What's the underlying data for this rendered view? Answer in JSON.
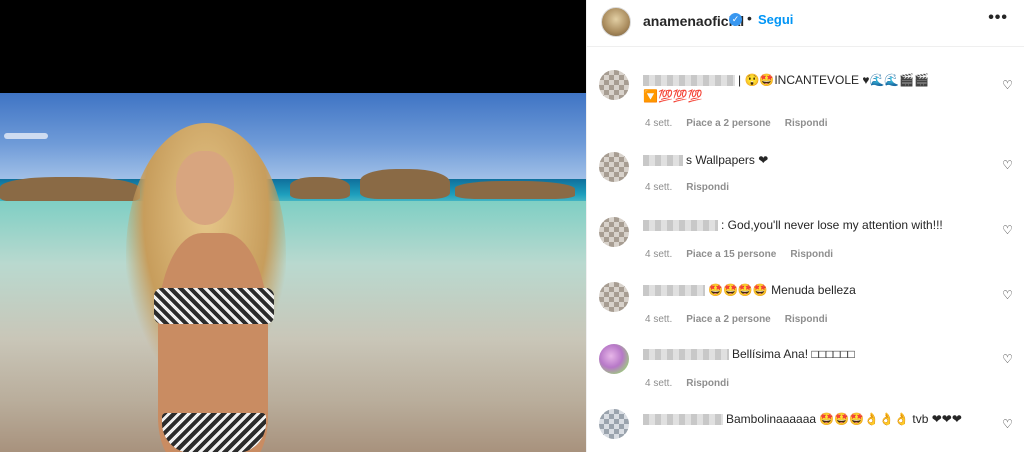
{
  "header": {
    "username": "anamenaoficial",
    "verified_mark": "✓",
    "separator": "•",
    "follow_label": "Segui",
    "more_label": "•••"
  },
  "comments": [
    {
      "text": "| 😲🤩INCANTEVOLE ♥🌊🌊🎬🎬",
      "text2": "🔽💯💯💯",
      "time": "4 sett.",
      "likes": "Piace a 2 persone",
      "reply": "Rispondi"
    },
    {
      "text": "s Wallpapers ❤",
      "time": "4 sett.",
      "reply": "Rispondi"
    },
    {
      "text": ": God,you'll never lose my attention with!!!",
      "time": "4 sett.",
      "likes": "Piace a 15 persone",
      "reply": "Rispondi"
    },
    {
      "text": "🤩🤩🤩🤩  Menuda belleza",
      "time": "4 sett.",
      "likes": "Piace a 2 persone",
      "reply": "Rispondi"
    },
    {
      "text": "Bellísima Ana! □□□□□□",
      "time": "4 sett.",
      "reply": "Rispondi"
    },
    {
      "text": "Bambolinaaaaaa 🤩🤩🤩👌👌👌 tvb ❤❤❤"
    }
  ],
  "icons": {
    "like": "heart-outline-icon",
    "more": "more-options-icon",
    "verified": "verified-badge-icon"
  },
  "colors": {
    "follow": "#0095f6",
    "verified": "#3897f0",
    "meta": "#8e8e8e"
  }
}
